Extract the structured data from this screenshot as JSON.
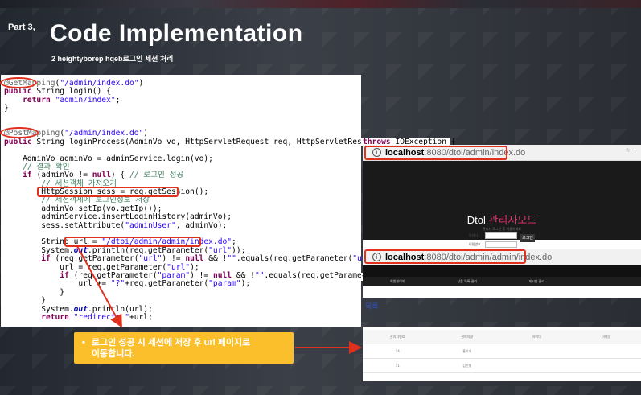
{
  "header": {
    "part": "Part 3,",
    "title": "Code Implementation",
    "subtitle": "2 heightyborep hqeb로그인 세션 처리"
  },
  "code": {
    "lines": [
      "@GetMapping(\"/admin/index.do\")",
      "public String login() {",
      "    return \"admin/index\";",
      "}",
      "",
      "",
      "@PostMapping(\"/admin/index.do\")",
      "public String loginProcess(AdminVo vo, HttpServletRequest req, HttpServletResponse res) throws IOException {",
      "",
      "    AdminVo adminVo = adminService.login(vo);",
      "    // 결과 확인",
      "    if (adminVo != null) { // 로그인 성공",
      "        // 세션객체 가져오기",
      "        HttpSession sess = req.getSession();",
      "        // 세션객체에 로그인정보 저장",
      "        adminVo.setIp(vo.getIp());",
      "        adminService.insertLoginHistory(adminVo);",
      "        sess.setAttribute(\"adminUser\", adminVo);",
      "",
      "        String url = \"/dtoi/admin/admin/index.do\";",
      "        System.out.println(req.getParameter(\"url\"));",
      "        if (req.getParameter(\"url\") != null && !\"\".equals(req.getParameter(\"url\"))) {",
      "            url = req.getParameter(\"url\");",
      "            if (req.getParameter(\"param\") != null && !\"\".equals(req.getParameter(\"param\"))) {",
      "                url += \"?\"+req.getParameter(\"param\");",
      "            }",
      "        }",
      "        System.out.println(url);",
      "        return \"redirect: \"+url;"
    ],
    "overflow_tail": "throws IOException {",
    "overflow_tail2": "{"
  },
  "browser1": {
    "url_host": "localhost",
    "url_path": ":8080/dtoi/admin/index.do",
    "hero_title": "Dtol ",
    "hero_title_accent": "관리자모드",
    "hero_sub": "관리자 로그인 후 이용하세요",
    "login_id_label": "아이디",
    "login_pw_label": "비밀번호",
    "login_button": "로그인",
    "tools": "☆ ⋮"
  },
  "browser2": {
    "url_host": "localhost",
    "url_path": ":8080/dtoi/admin/admin/index.do",
    "tabs": [
      "회원페이지",
      "상품 목록 관리",
      "게시판 관리",
      ""
    ],
    "section_title": "목록"
  },
  "table": {
    "headers": [
      "관리자번호",
      "관리자명",
      "아이디",
      "이메일"
    ],
    "rows": [
      [
        "14",
        "홍이나",
        "",
        ""
      ],
      [
        "11",
        "김민형",
        "",
        ""
      ]
    ]
  },
  "callout": {
    "bullet": "•",
    "text_line1": "로그인 성공 시 세션에 저장 후 url 페이지로",
    "text_line2": "이동합니다."
  },
  "colors": {
    "highlight": "#e0301e",
    "callout_bg": "#fbbf2c",
    "accent_pink": "#e0306a"
  }
}
